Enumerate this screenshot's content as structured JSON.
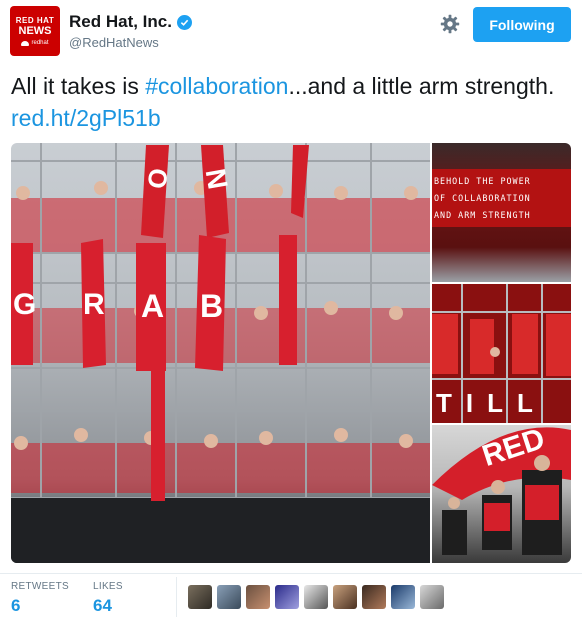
{
  "account": {
    "name": "Red Hat, Inc.",
    "handle": "@RedHatNews",
    "avatar": {
      "line1": "RED HAT",
      "line2": "NEWS",
      "line3": "redhat"
    }
  },
  "header": {
    "follow_label": "Following"
  },
  "tweet": {
    "text_before": "All it takes is ",
    "hashtag": "#collaboration",
    "text_after": "...and a little arm strength. ",
    "link": "red.ht/2gPl51b"
  },
  "media": {
    "panel_letters": [
      "G",
      "R",
      "A",
      "B"
    ],
    "top_cards": [
      "O",
      "N"
    ],
    "sign": [
      "BEHOLD THE POWER",
      "OF COLLABORATION",
      "AND ARM STRENGTH"
    ],
    "side_word": "TILL",
    "dome_text": "RED"
  },
  "stats": {
    "retweets_label": "RETWEETS",
    "retweets": "6",
    "likes_label": "LIKES",
    "likes": "64"
  },
  "likers_count": 9,
  "colors": {
    "brand_red": "#cc0000",
    "twitter_blue": "#1da1f2",
    "link_blue": "#1b95e0"
  }
}
